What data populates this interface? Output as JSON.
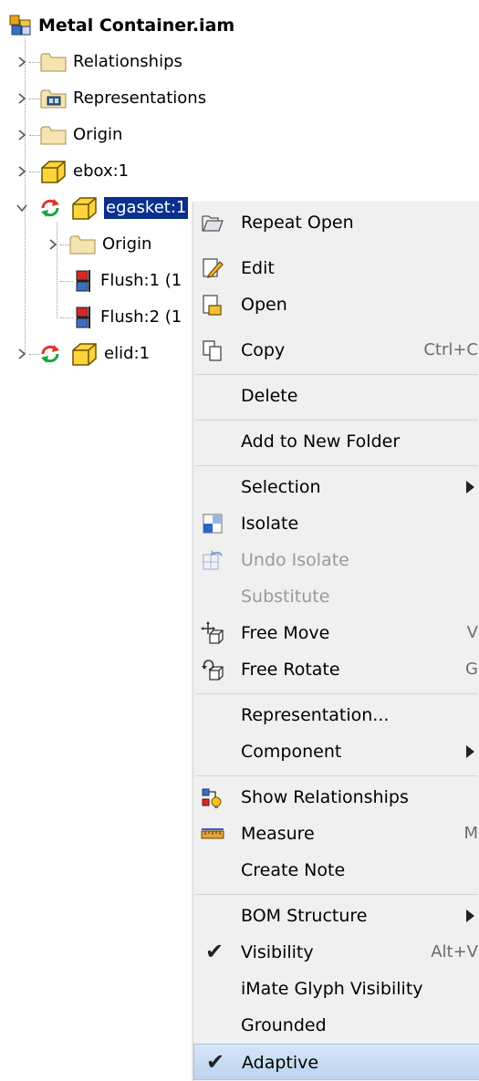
{
  "tree": {
    "root": "Metal Container.iam",
    "nodes": [
      {
        "label": "Relationships"
      },
      {
        "label": "Representations"
      },
      {
        "label": "Origin"
      },
      {
        "label": "ebox:1"
      },
      {
        "label": "egasket:1"
      },
      {
        "label": "Origin"
      },
      {
        "label": "Flush:1 (1"
      },
      {
        "label": "Flush:2 (1"
      },
      {
        "label": "elid:1"
      }
    ]
  },
  "menu": {
    "items": [
      {
        "label": "Repeat Open",
        "icon": "folder-open-icon"
      },
      {
        "label": "Edit",
        "icon": "edit-icon"
      },
      {
        "label": "Open",
        "icon": "open-document-icon"
      },
      {
        "label": "Copy",
        "shortcut": "Ctrl+C",
        "icon": "copy-icon"
      },
      {
        "label": "Delete"
      },
      {
        "label": "Add to New Folder"
      },
      {
        "label": "Selection",
        "submenu": true
      },
      {
        "label": "Isolate",
        "icon": "isolate-icon"
      },
      {
        "label": "Undo Isolate",
        "icon": "undo-isolate-icon",
        "disabled": true
      },
      {
        "label": "Substitute",
        "disabled": true
      },
      {
        "label": "Free Move",
        "shortcut": "V",
        "icon": "free-move-icon"
      },
      {
        "label": "Free Rotate",
        "shortcut": "G",
        "icon": "free-rotate-icon"
      },
      {
        "label": "Representation..."
      },
      {
        "label": "Component",
        "submenu": true
      },
      {
        "label": "Show Relationships",
        "icon": "show-relationships-icon"
      },
      {
        "label": "Measure",
        "shortcut": "M",
        "icon": "ruler-icon"
      },
      {
        "label": "Create Note"
      },
      {
        "label": "BOM Structure",
        "submenu": true
      },
      {
        "label": "Visibility",
        "shortcut": "Alt+V",
        "checked": true
      },
      {
        "label": "iMate Glyph Visibility"
      },
      {
        "label": "Grounded"
      },
      {
        "label": "Adaptive",
        "checked": true,
        "highlighted": true
      }
    ]
  },
  "colors": {
    "selection": "#0a2f8c",
    "menu_bg": "#f0f0f0",
    "highlight": "#c9dcf2",
    "folder": "#f5e4b0",
    "part_yellow": "#ffd53a",
    "adaptive_red": "#e0332b",
    "adaptive_green": "#1aa340"
  }
}
